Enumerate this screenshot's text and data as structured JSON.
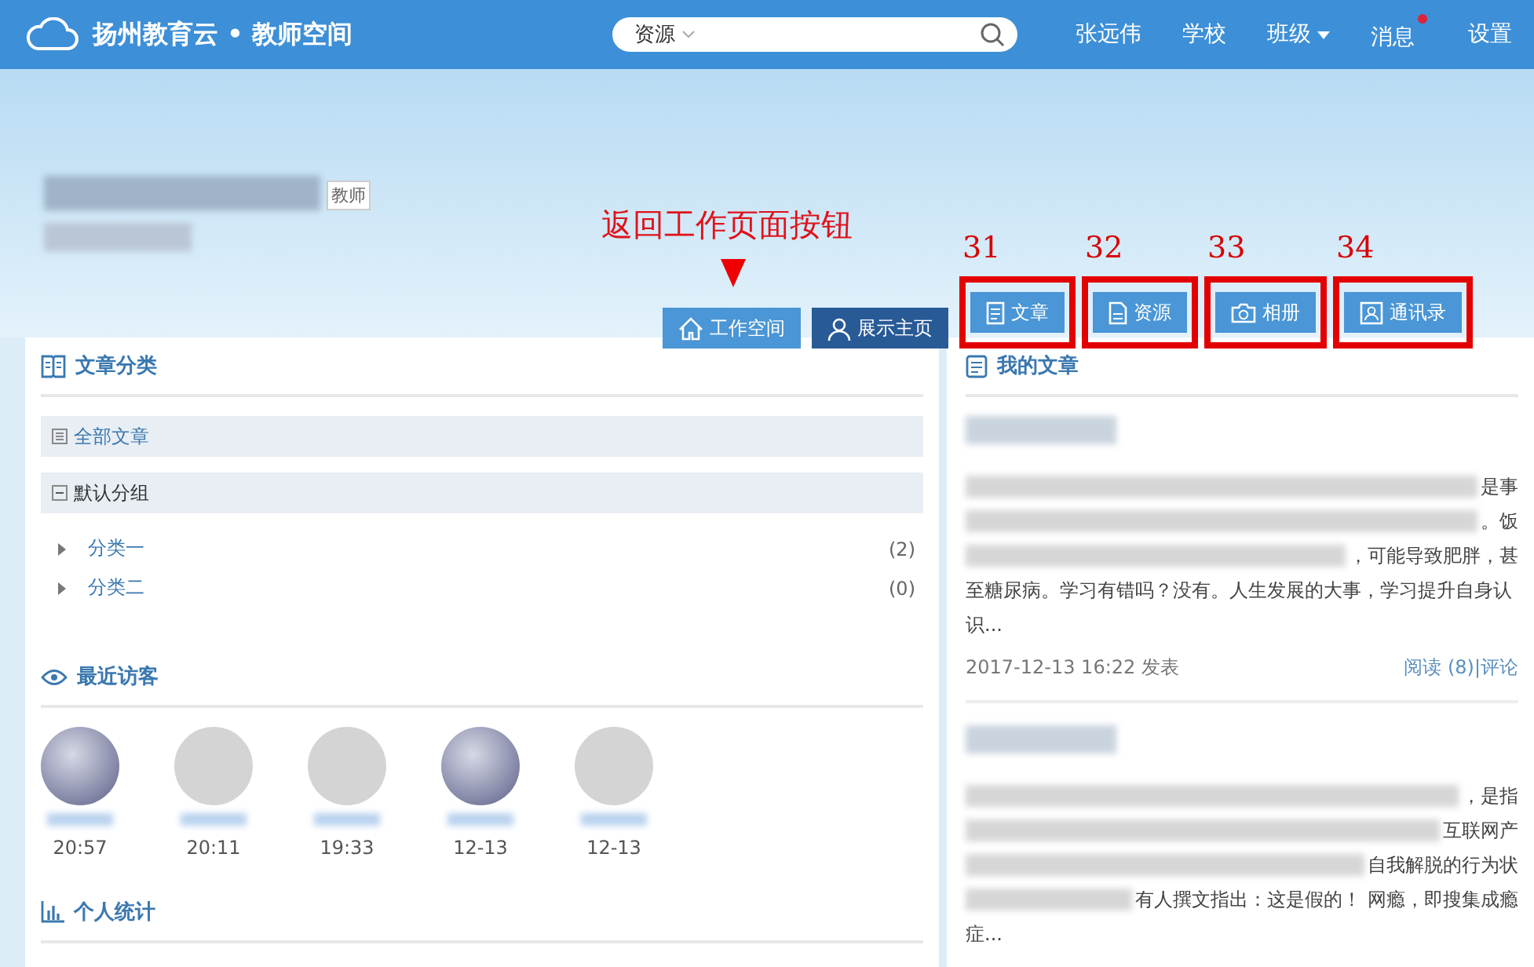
{
  "header": {
    "brand": "扬州教育云 • 教师空间",
    "search": {
      "scope": "资源"
    },
    "nav": [
      {
        "label": "张远伟",
        "dropdown": false,
        "badge": false
      },
      {
        "label": "学校",
        "dropdown": false,
        "badge": false
      },
      {
        "label": "班级",
        "dropdown": true,
        "badge": false
      },
      {
        "label": "消息",
        "dropdown": false,
        "badge": true
      },
      {
        "label": "设置",
        "dropdown": false,
        "badge": false
      }
    ]
  },
  "profile": {
    "role_tag": "教师"
  },
  "annotation": "返回工作页面按钮",
  "tabs": [
    {
      "label": "工作空间",
      "kind": "home",
      "highlighted": false
    },
    {
      "label": "展示主页",
      "kind": "profile",
      "highlighted": false
    },
    {
      "label": "文章",
      "kind": "articles",
      "highlighted": true,
      "callout": "31"
    },
    {
      "label": "资源",
      "kind": "resources",
      "highlighted": true,
      "callout": "32"
    },
    {
      "label": "相册",
      "kind": "album",
      "highlighted": true,
      "callout": "33"
    },
    {
      "label": "通讯录",
      "kind": "contacts",
      "highlighted": true,
      "callout": "34"
    }
  ],
  "categories": {
    "title": "文章分类",
    "all_label": "全部文章",
    "group": {
      "label": "默认分组",
      "expanded": true,
      "items": [
        {
          "label": "分类一",
          "count": "(2)"
        },
        {
          "label": "分类二",
          "count": "(0)"
        }
      ]
    }
  },
  "visitors": {
    "title": "最近访客",
    "items": [
      {
        "time": "20:57",
        "kind": "photo"
      },
      {
        "time": "20:11",
        "kind": "default"
      },
      {
        "time": "19:33",
        "kind": "default"
      },
      {
        "time": "12-13",
        "kind": "photo"
      },
      {
        "time": "12-13",
        "kind": "default"
      }
    ]
  },
  "stats": {
    "title": "个人统计"
  },
  "articles": {
    "title": "我的文章",
    "items": [
      {
        "lines": [
          {
            "text": "是事",
            "blurred": true
          },
          {
            "text": "。饭",
            "blurred": true
          },
          {
            "text": "，可能导致肥胖，甚",
            "blurred": true
          },
          {
            "text": "至糖尿病。学习有错吗？没有。人生发展的大事，学习提升自身认",
            "blurred": false
          },
          {
            "text": "识...",
            "blurred": false
          }
        ],
        "date": "2017-12-13 16:22 发表",
        "reads": "阅读 (8)",
        "comment": "|评论"
      },
      {
        "lines": [
          {
            "text": "，是指",
            "blurred": true
          },
          {
            "text": "互联网产",
            "blurred": true
          },
          {
            "text": "自我解脱的行为状",
            "blurred": true
          },
          {
            "text": "有人撰文指出：这是假的！ 网瘾，即搜集成瘾",
            "blurred": true
          },
          {
            "text": "症...",
            "blurred": false
          }
        ]
      }
    ]
  }
}
